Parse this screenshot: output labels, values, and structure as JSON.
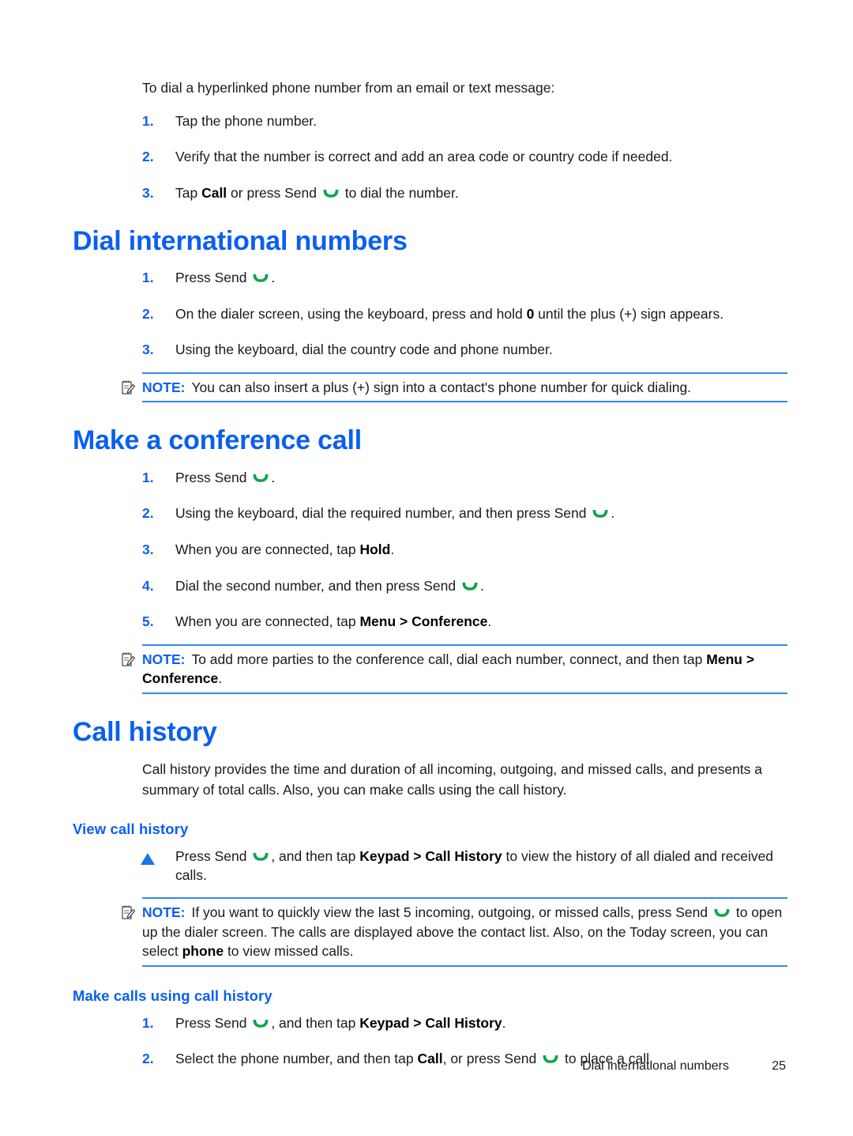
{
  "document": {
    "type": "user-guide-page",
    "colors": {
      "heading_blue": "#0a5ff0",
      "rule_blue": "#2f8bf0",
      "send_green": "#11a44a",
      "body_black": "#1a1a1a"
    }
  },
  "intro": {
    "text": "To dial a hyperlinked phone number from an email or text message:"
  },
  "hyperlink_steps": [
    {
      "marker": "1.",
      "pre": "Tap the phone number.",
      "bold": "",
      "post": ""
    },
    {
      "marker": "2.",
      "pre": "Verify that the number is correct and add an area code or country code if needed.",
      "bold": "",
      "post": ""
    },
    {
      "marker": "3.",
      "pre": "Tap ",
      "bold": "Call",
      "post": " or press Send ",
      "post2": " to dial the number."
    }
  ],
  "sections": [
    {
      "id": "dial-international-numbers",
      "title": "Dial international numbers",
      "steps": [
        {
          "marker": "1.",
          "pre": "Press Send ",
          "post": "."
        },
        {
          "marker": "2.",
          "pre": "On the dialer screen, using the keyboard, press and hold ",
          "bold": "0",
          "post": " until the plus (+) sign appears."
        },
        {
          "marker": "3.",
          "pre": "Using the keyboard, dial the country code and phone number.",
          "post": ""
        }
      ],
      "note": {
        "label": "NOTE:",
        "text": "You can also insert a plus (+) sign into a contact's phone number for quick dialing."
      }
    },
    {
      "id": "make-a-conference-call",
      "title": "Make a conference call",
      "steps": [
        {
          "marker": "1.",
          "pre": "Press Send ",
          "post": "."
        },
        {
          "marker": "2.",
          "pre": "Using the keyboard, dial the required number, and then press Send ",
          "post": "."
        },
        {
          "marker": "3.",
          "pre": "When you are connected, tap ",
          "bold": "Hold",
          "post": "."
        },
        {
          "marker": "4.",
          "pre": "Dial the second number, and then press Send ",
          "post": "."
        },
        {
          "marker": "5.",
          "pre": "When you are connected, tap ",
          "bold": "Menu > Conference",
          "post": "."
        }
      ],
      "note": {
        "label": "NOTE:",
        "pre": "To add more parties to the conference call, dial each number, connect, and then tap ",
        "bold": "Menu > Conference",
        "post": "."
      }
    }
  ],
  "call_history": {
    "title": "Call history",
    "paragraph": "Call history provides the time and duration of all incoming, outgoing, and missed calls, and presents a summary of total calls. Also, you can make calls using the call history.",
    "view_subsection": {
      "title": "View call history",
      "bullet": {
        "marker": "triangle",
        "pre": "Press Send ",
        "mid": ", and then tap ",
        "bold": "Keypad > Call History",
        "post": " to view the history of all dialed and received calls."
      },
      "note": {
        "label": "NOTE:",
        "pre": "If you want to quickly view the last 5 incoming, outgoing, or missed calls, press Send ",
        "mid": " to open up the dialer screen. The calls are displayed above the contact list. Also, on the Today screen, you can select ",
        "bold": "phone",
        "post": " to view missed calls."
      }
    },
    "make_subsection": {
      "title": "Make calls using call history",
      "steps": [
        {
          "marker": "1.",
          "pre": "Press Send ",
          "mid": ", and then tap ",
          "bold": "Keypad > Call History",
          "post": "."
        },
        {
          "marker": "2.",
          "pre": "Select the phone number, and then tap ",
          "bold": "Call",
          "mid": ", or press Send ",
          "post": " to place a call."
        }
      ]
    }
  },
  "footer": {
    "title": "Dial international numbers",
    "page_number": "25"
  },
  "icons": {
    "send": "send-phone-icon",
    "note": "note-pad-pen-icon",
    "bullet": "triangle-bullet-icon"
  }
}
